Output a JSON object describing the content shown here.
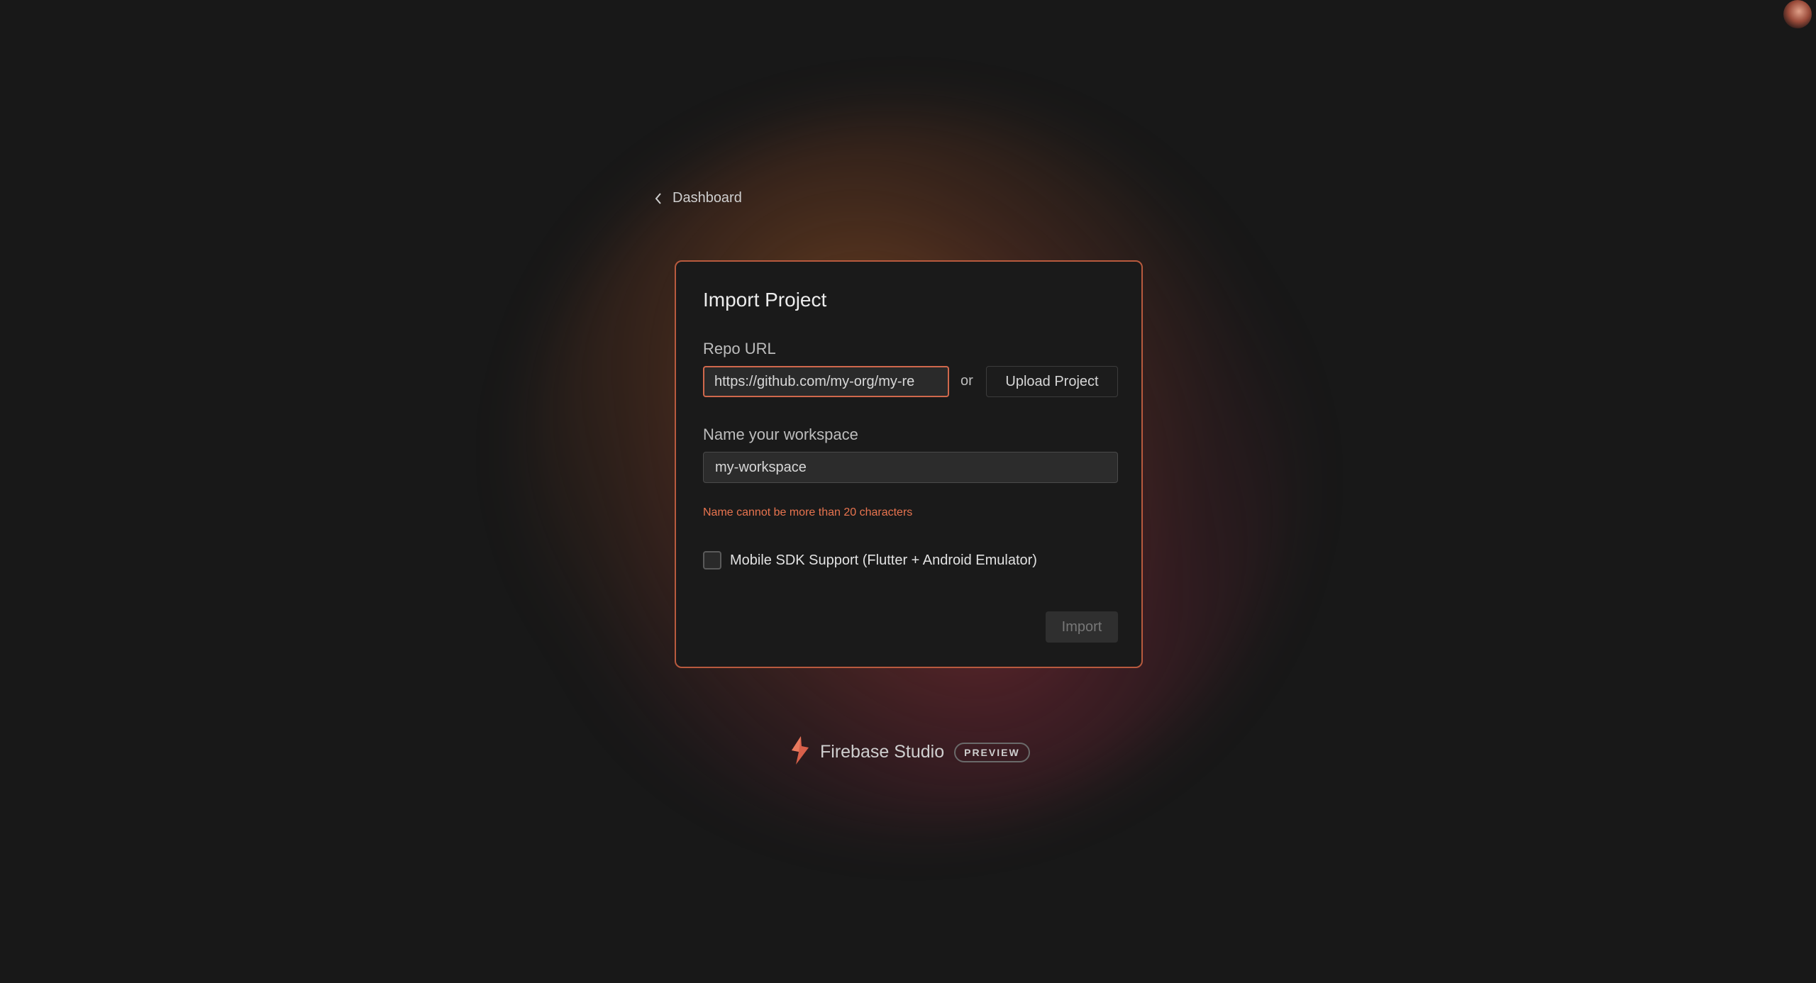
{
  "nav": {
    "back_label": "Dashboard"
  },
  "card": {
    "title": "Import Project",
    "repo_label": "Repo URL",
    "repo_value": "https://github.com/my-org/my-re",
    "or_text": "or",
    "upload_label": "Upload Project",
    "workspace_label": "Name your workspace",
    "workspace_value": "my-workspace",
    "error_text": "Name cannot be more than 20 characters",
    "checkbox_label": "Mobile SDK Support (Flutter + Android Emulator)",
    "checkbox_checked": false,
    "import_label": "Import"
  },
  "brand": {
    "name": "Firebase Studio",
    "badge": "PREVIEW"
  },
  "icons": {
    "back": "chevron-left-icon",
    "logo": "firebase-studio-logo-icon",
    "avatar": "user-avatar"
  },
  "colors": {
    "background": "#181818",
    "accent": "#d0684c",
    "error": "#e8744f"
  }
}
